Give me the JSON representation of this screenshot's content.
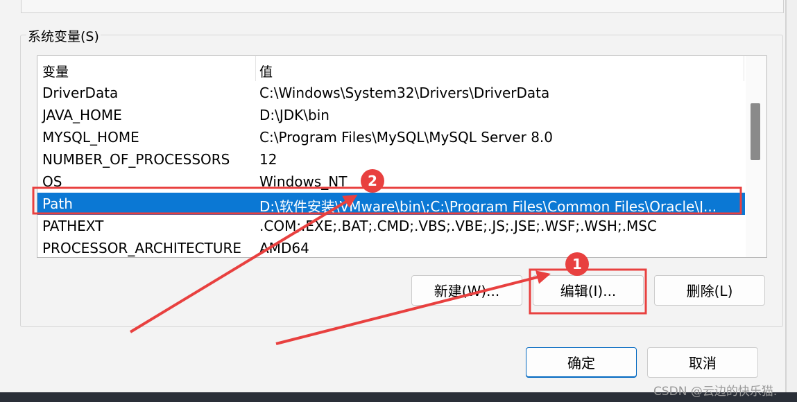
{
  "system_variables": {
    "group_label": "系统变量(S)",
    "columns": {
      "variable": "变量",
      "value": "值"
    },
    "rows": [
      {
        "name": "DriverData",
        "value": "C:\\Windows\\System32\\Drivers\\DriverData"
      },
      {
        "name": "JAVA_HOME",
        "value": "D:\\JDK\\bin"
      },
      {
        "name": "MYSQL_HOME",
        "value": "C:\\Program Files\\MySQL\\MySQL Server 8.0"
      },
      {
        "name": "NUMBER_OF_PROCESSORS",
        "value": "12"
      },
      {
        "name": "OS",
        "value": "Windows_NT"
      },
      {
        "name": "Path",
        "value": "D:\\软件安装\\VMware\\bin\\;C:\\Program Files\\Common Files\\Oracle\\J..."
      },
      {
        "name": "PATHEXT",
        "value": ".COM;.EXE;.BAT;.CMD;.VBS;.VBE;.JS;.JSE;.WSF;.WSH;.MSC"
      },
      {
        "name": "PROCESSOR_ARCHITECTURE",
        "value": "AMD64"
      }
    ],
    "selected_row": "Path",
    "buttons": {
      "new": "新建(W)...",
      "edit": "编辑(I)...",
      "delete": "删除(L)"
    }
  },
  "dialog_buttons": {
    "ok": "确定",
    "cancel": "取消"
  },
  "annotations": {
    "badge1": "1",
    "badge2": "2",
    "color": "#e8403f"
  },
  "selection_color": "#0b78d4",
  "watermark": "CSDN @云边的快乐猫."
}
